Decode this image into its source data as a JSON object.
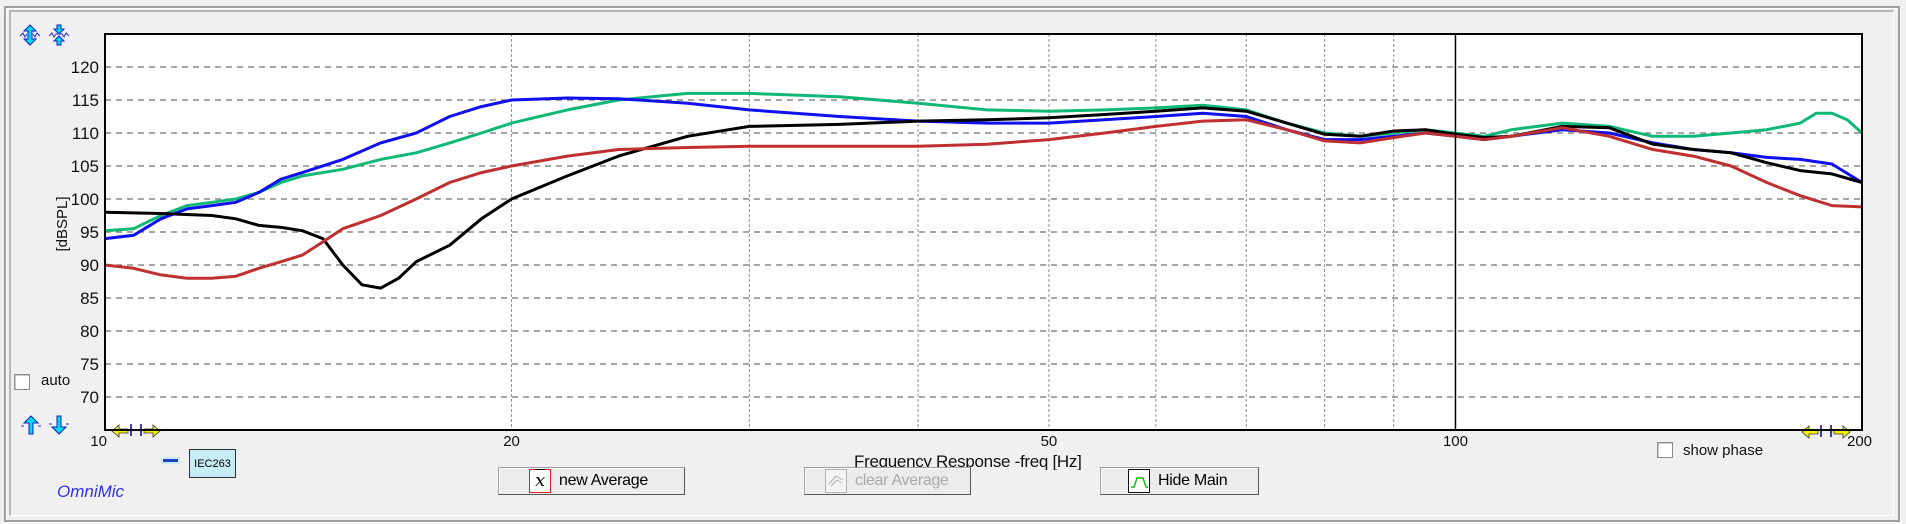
{
  "app": {
    "brand": "OmniMic"
  },
  "controls": {
    "auto_label": "auto",
    "auto_checked": false,
    "show_phase_label": "show phase",
    "show_phase_checked": false,
    "legend_tag": "IEC263",
    "new_average_label": "new Average",
    "clear_average_label": "clear Average",
    "clear_average_enabled": false,
    "hide_main_label": "Hide Main",
    "icons": [
      "expand-vertical-icon",
      "compress-vertical-icon",
      "scroll-up-icon",
      "scroll-down-icon",
      "x-range-left-handle-icon",
      "x-range-right-handle-icon"
    ]
  },
  "chart_data": {
    "type": "line",
    "title": "",
    "xlabel": "Frequency Response -freq [Hz]",
    "ylabel": "[dBSPL]",
    "xscale": "log",
    "xlim": [
      10,
      200
    ],
    "ylim": [
      65,
      125
    ],
    "xticks": [
      10,
      20,
      50,
      100,
      200
    ],
    "xtick_labels": [
      "10",
      "20",
      "50",
      "100",
      "200"
    ],
    "xgrid_minor": [
      30,
      40,
      60,
      70,
      80,
      90
    ],
    "yticks": [
      70,
      75,
      80,
      85,
      90,
      95,
      100,
      105,
      110,
      115,
      120
    ],
    "ytick_labels": [
      "70",
      "75",
      "80",
      "85",
      "90",
      "95",
      "100",
      "105",
      "110",
      "115",
      "120"
    ],
    "grid": true,
    "marker_line_x": 100,
    "series": [
      {
        "name": "green",
        "color": "#10b878",
        "x": [
          10,
          10.5,
          11,
          11.5,
          12,
          12.5,
          13,
          13.5,
          14,
          15,
          16,
          17,
          18,
          19,
          20,
          22,
          24,
          27,
          30,
          35,
          40,
          45,
          50,
          55,
          60,
          65,
          70,
          75,
          80,
          85,
          90,
          95,
          100,
          105,
          110,
          120,
          130,
          140,
          150,
          160,
          170,
          180,
          185,
          190,
          195,
          200
        ],
        "y": [
          95.2,
          95.5,
          97.5,
          99,
          99.5,
          100,
          101,
          102.5,
          103.5,
          104.5,
          106,
          107,
          108.5,
          110,
          111.5,
          113.5,
          115,
          116,
          116,
          115.5,
          114.5,
          113.5,
          113.3,
          113.5,
          113.8,
          114.2,
          113.5,
          111.5,
          110,
          109.5,
          110,
          110.5,
          110,
          109.5,
          110.5,
          111.5,
          111,
          109.5,
          109.5,
          110,
          110.5,
          111.5,
          113,
          113,
          112,
          110
        ]
      },
      {
        "name": "blue",
        "color": "#1010f0",
        "x": [
          10,
          10.5,
          11,
          11.5,
          12,
          12.5,
          13,
          13.5,
          14,
          15,
          16,
          17,
          18,
          19,
          20,
          22,
          24,
          27,
          30,
          35,
          40,
          45,
          50,
          55,
          60,
          65,
          70,
          75,
          80,
          85,
          90,
          95,
          100,
          105,
          110,
          120,
          130,
          140,
          150,
          160,
          170,
          180,
          190,
          200
        ],
        "y": [
          94,
          94.5,
          97,
          98.5,
          99,
          99.5,
          101,
          103,
          104,
          106,
          108.5,
          110,
          112.5,
          114,
          115,
          115.3,
          115.2,
          114.5,
          113.5,
          112.5,
          111.8,
          111.5,
          111.5,
          112,
          112.5,
          113,
          112.5,
          110.5,
          109,
          109,
          109.5,
          110,
          109.5,
          109,
          109.5,
          110.5,
          110,
          108.5,
          107.5,
          107,
          106.3,
          106,
          105.3,
          102.5
        ]
      },
      {
        "name": "black",
        "color": "#000000",
        "x": [
          10,
          11,
          12,
          12.5,
          13,
          13.5,
          14,
          14.5,
          15,
          15.5,
          16,
          16.5,
          17,
          18,
          19,
          20,
          22,
          24,
          27,
          30,
          35,
          40,
          45,
          50,
          55,
          60,
          65,
          70,
          75,
          80,
          85,
          90,
          95,
          100,
          105,
          110,
          120,
          130,
          140,
          150,
          160,
          170,
          180,
          190,
          200
        ],
        "y": [
          98,
          97.8,
          97.5,
          97,
          96,
          95.7,
          95.2,
          94,
          90,
          87,
          86.5,
          88,
          90.5,
          93,
          97,
          100,
          103.5,
          106.5,
          109.5,
          111,
          111.3,
          111.8,
          112,
          112.3,
          112.8,
          113.3,
          113.8,
          113.3,
          111.5,
          109.8,
          109.5,
          110.3,
          110.5,
          109.8,
          109.3,
          109.5,
          111,
          110.8,
          108.3,
          107.5,
          107,
          105.5,
          104.3,
          103.8,
          102.5
        ]
      },
      {
        "name": "red",
        "color": "#c03030",
        "x": [
          10,
          10.5,
          11,
          11.5,
          12,
          12.5,
          13,
          13.5,
          14,
          14.5,
          15,
          15.5,
          16,
          17,
          18,
          19,
          20,
          22,
          24,
          27,
          30,
          35,
          40,
          45,
          50,
          55,
          60,
          65,
          70,
          75,
          80,
          85,
          90,
          95,
          100,
          105,
          110,
          120,
          130,
          140,
          150,
          160,
          170,
          180,
          190,
          200
        ],
        "y": [
          90,
          89.5,
          88.5,
          88,
          88,
          88.3,
          89.5,
          90.5,
          91.5,
          93.5,
          95.5,
          96.5,
          97.5,
          100,
          102.5,
          104,
          105,
          106.5,
          107.5,
          107.8,
          108,
          108,
          108,
          108.3,
          109,
          110,
          111,
          111.8,
          112,
          110.5,
          108.8,
          108.5,
          109.3,
          110,
          109.5,
          109,
          109.5,
          110.8,
          109.5,
          107.5,
          106.5,
          105,
          102.5,
          100.5,
          99,
          98.8
        ]
      }
    ]
  }
}
